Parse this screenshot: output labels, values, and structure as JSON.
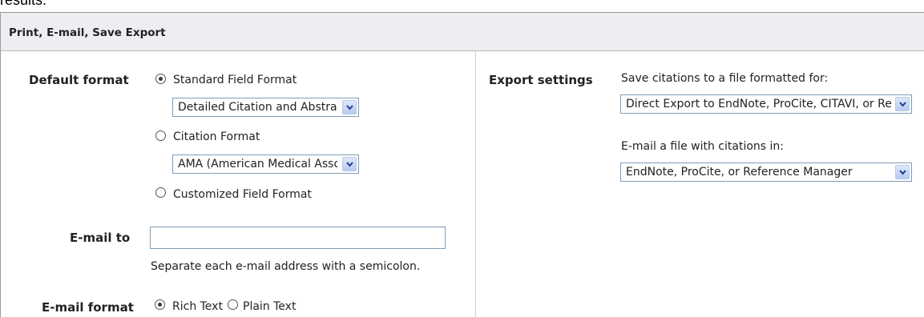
{
  "top_cut_text": "results.",
  "panel": {
    "title": "Print, E-mail, Save Export"
  },
  "left": {
    "default_format_label": "Default format",
    "formats": [
      {
        "label": "Standard Field Format",
        "checked": true,
        "select_value": "Detailed Citation and Abstract"
      },
      {
        "label": "Citation Format",
        "checked": false,
        "select_value": "AMA (American Medical Assoc.)"
      },
      {
        "label": "Customized Field Format",
        "checked": false
      }
    ],
    "email_to_label": "E-mail to",
    "email_to_value": "",
    "email_hint": "Separate each e-mail address with a semicolon.",
    "email_format_label": "E-mail format",
    "email_formats": [
      {
        "label": "Rich Text",
        "checked": true
      },
      {
        "label": "Plain Text",
        "checked": false
      }
    ]
  },
  "right": {
    "export_settings_label": "Export settings",
    "save_caption": "Save citations to a file formatted for:",
    "save_select_value": "Direct Export to EndNote, ProCite, CITAVI, or Reference Manager",
    "email_caption": "E-mail a file with citations in:",
    "email_select_value": "EndNote, ProCite, or Reference Manager"
  }
}
